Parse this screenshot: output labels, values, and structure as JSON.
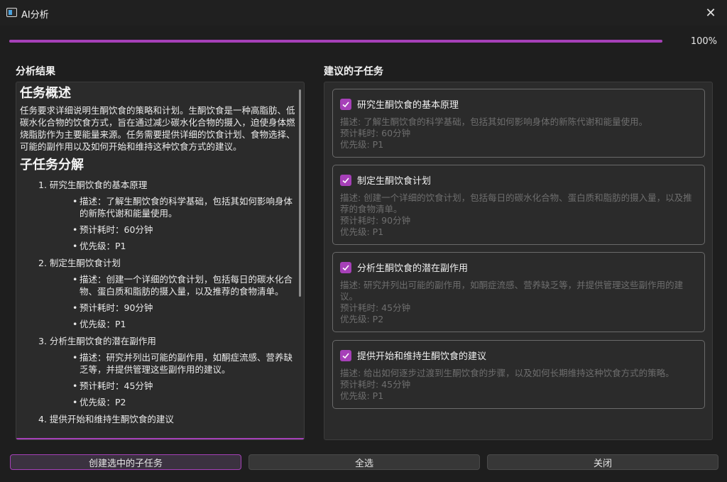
{
  "window": {
    "title": "AI分析",
    "close_glyph": "✕"
  },
  "progress": {
    "value": 1.0,
    "text": "100%",
    "accent": "#a640b8"
  },
  "left": {
    "heading": "分析结果",
    "overview_heading": "任务概述",
    "overview_text": "任务要求详细说明生酮饮食的策略和计划。生酮饮食是一种高脂肪、低碳水化合物的饮食方式，旨在通过减少碳水化合物的摄入，迫使身体燃烧脂肪作为主要能量来源。任务需要提供详细的饮食计划、食物选择、可能的副作用以及如何开始和维持这种饮食方式的建议。",
    "breakdown_heading": "子任务分解",
    "items": [
      {
        "title": "1. 研究生酮饮食的基本原理",
        "desc": "描述：了解生酮饮食的科学基础，包括其如何影响身体的新陈代谢和能量使用。",
        "time": "预计耗时：60分钟",
        "priority": "优先级：P1"
      },
      {
        "title": "2. 制定生酮饮食计划",
        "desc": "描述：创建一个详细的饮食计划，包括每日的碳水化合物、蛋白质和脂肪的摄入量，以及推荐的食物清单。",
        "time": "预计耗时：90分钟",
        "priority": "优先级：P1"
      },
      {
        "title": "3. 分析生酮饮食的潜在副作用",
        "desc": "描述：研究并列出可能的副作用，如酮症流感、营养缺乏等，并提供管理这些副作用的建议。",
        "time": "预计耗时：45分钟",
        "priority": "优先级：P2"
      },
      {
        "title": "4. 提供开始和维持生酮饮食的建议"
      }
    ]
  },
  "right": {
    "heading": "建议的子任务",
    "tasks": [
      {
        "title": "研究生酮饮食的基本原理",
        "checked": true,
        "desc": "描述: 了解生酮饮食的科学基础，包括其如何影响身体的新陈代谢和能量使用。",
        "time": "预计耗时: 60分钟",
        "priority": "优先级: P1"
      },
      {
        "title": "制定生酮饮食计划",
        "checked": true,
        "desc": "描述: 创建一个详细的饮食计划，包括每日的碳水化合物、蛋白质和脂肪的摄入量，以及推荐的食物清单。",
        "time": "预计耗时: 90分钟",
        "priority": "优先级: P1"
      },
      {
        "title": "分析生酮饮食的潜在副作用",
        "checked": true,
        "desc": "描述: 研究并列出可能的副作用，如酮症流感、营养缺乏等，并提供管理这些副作用的建议。",
        "time": "预计耗时: 45分钟",
        "priority": "优先级: P2"
      },
      {
        "title": "提供开始和维持生酮饮食的建议",
        "checked": true,
        "desc": "描述: 给出如何逐步过渡到生酮饮食的步骤，以及如何长期维持这种饮食方式的策略。",
        "time": "预计耗时: 45分钟",
        "priority": "优先级: P1"
      }
    ]
  },
  "buttons": {
    "create": "创建选中的子任务",
    "select_all": "全选",
    "close": "关闭"
  }
}
